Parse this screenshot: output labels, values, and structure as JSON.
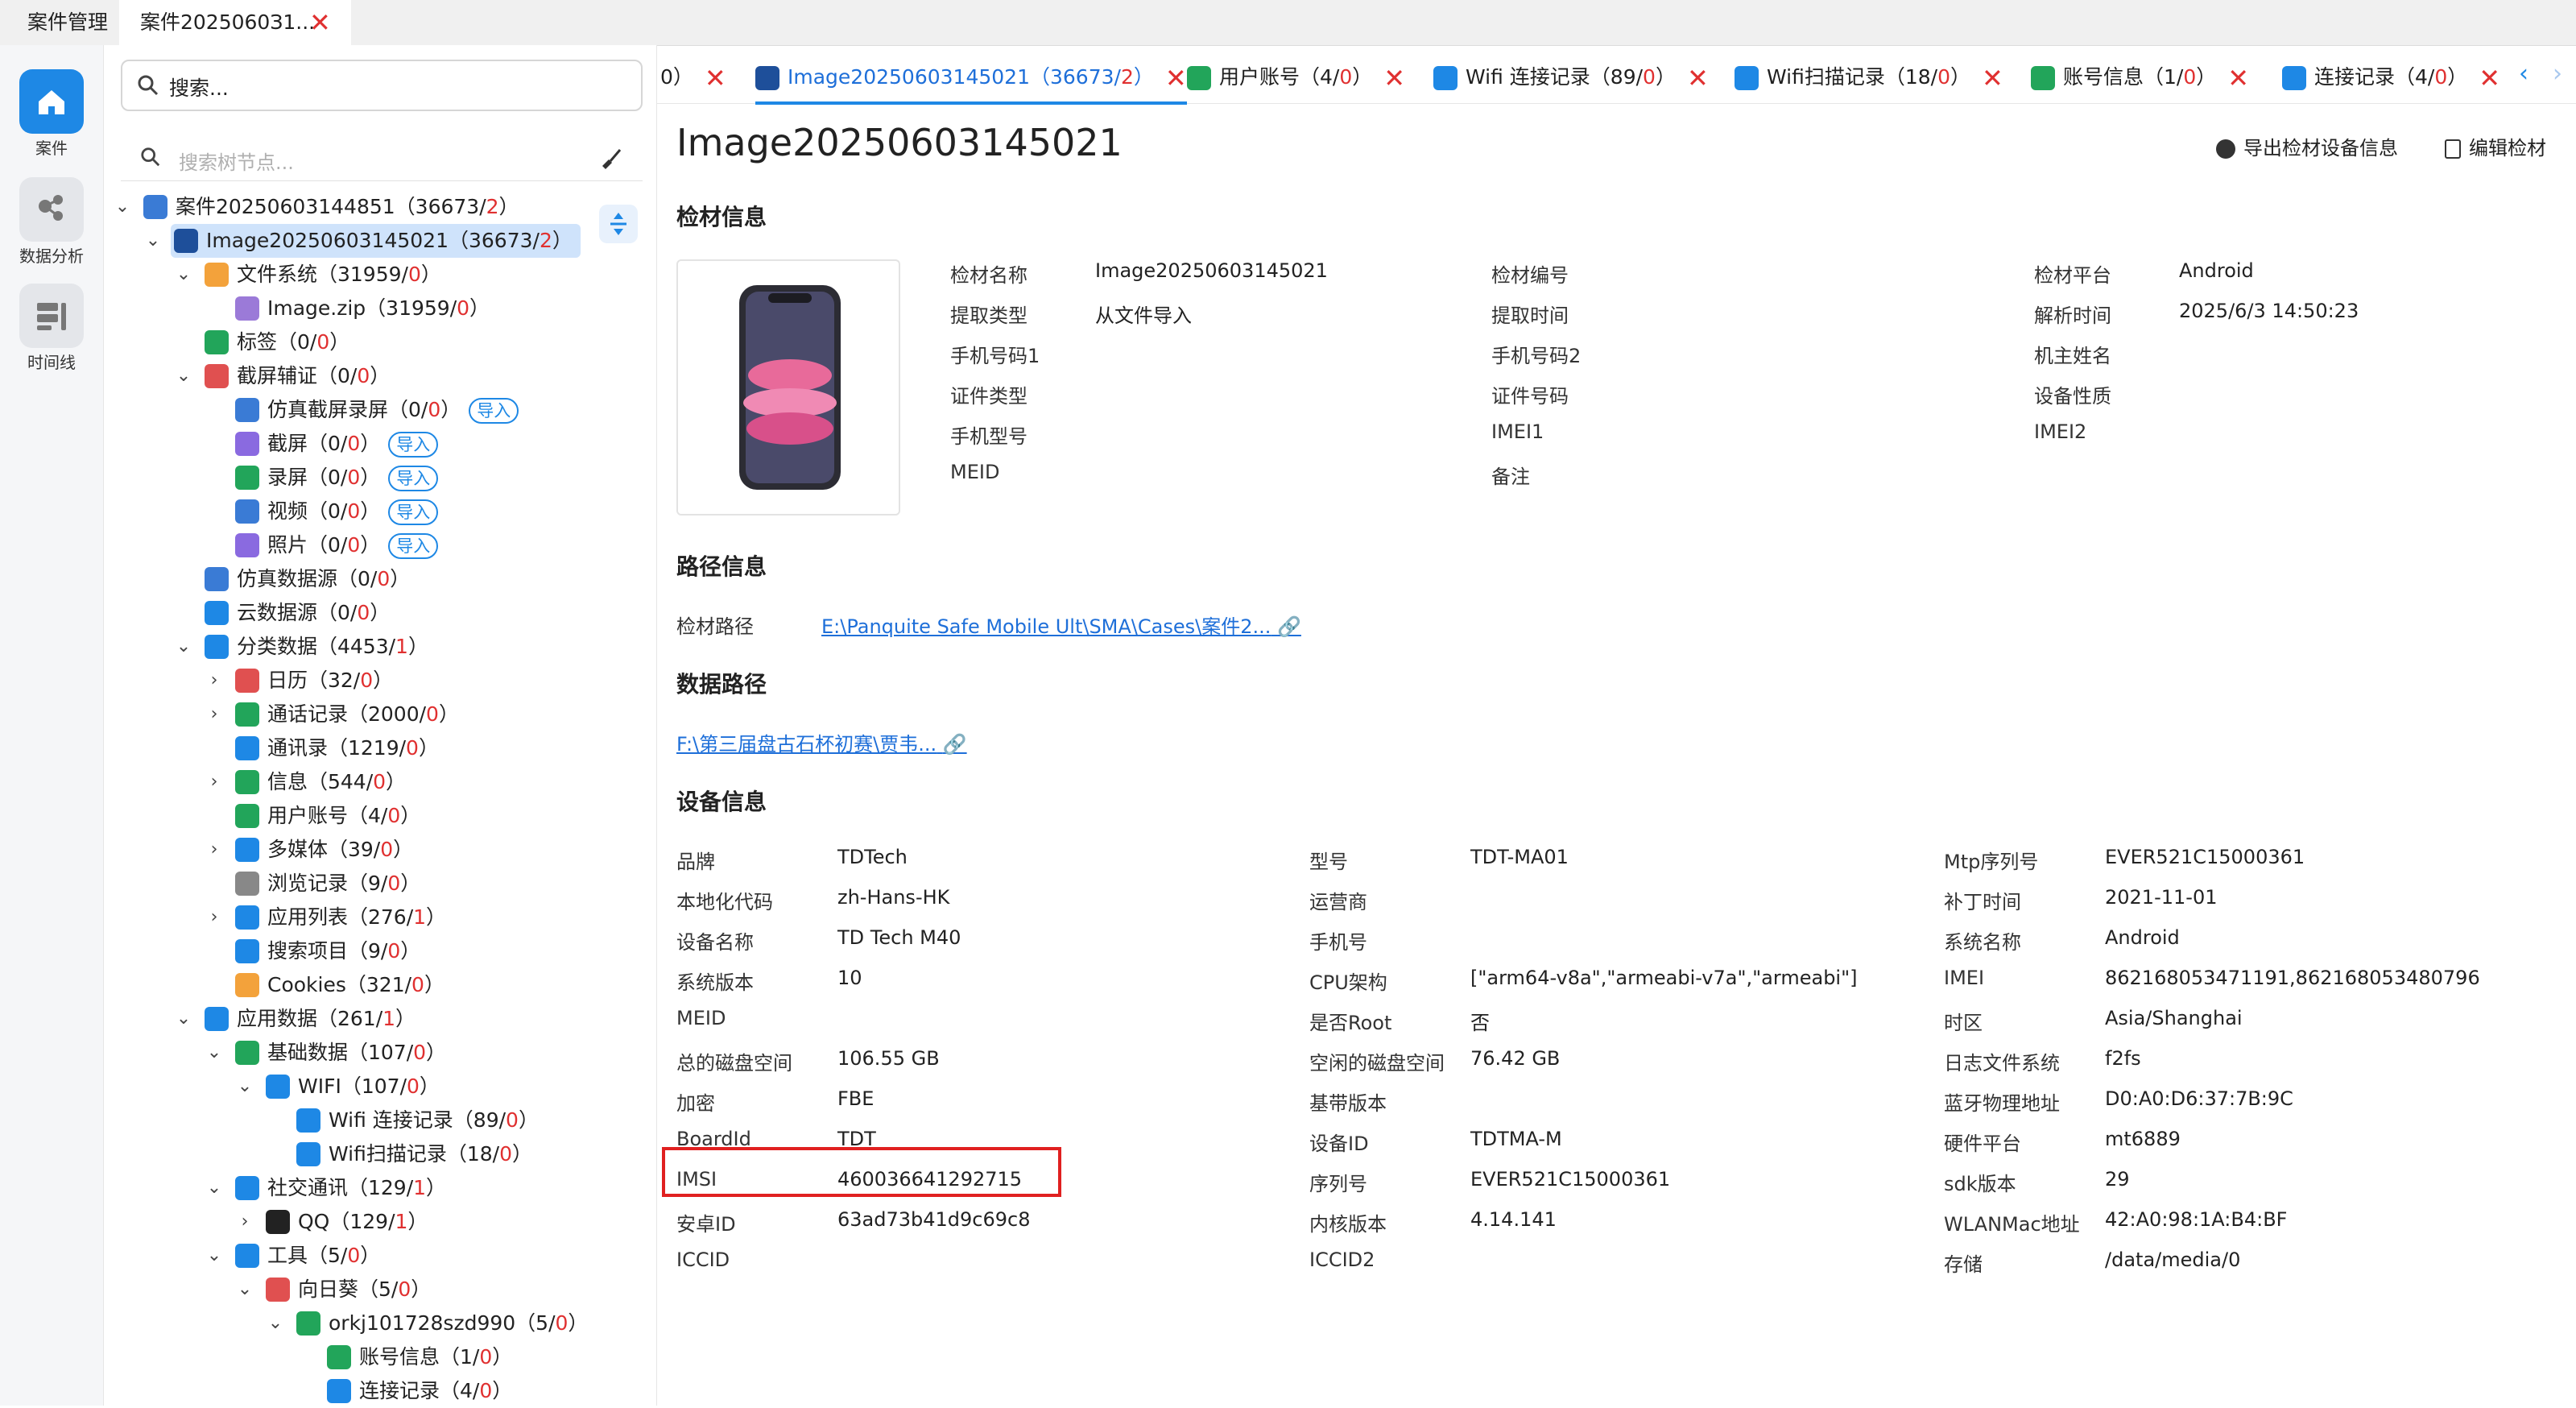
{
  "top_tabs": [
    {
      "label": "案件管理"
    },
    {
      "label": "案件2025060З1..."
    }
  ],
  "rail": [
    {
      "label": "案件"
    },
    {
      "label": "数据分析"
    },
    {
      "label": "时间线"
    }
  ],
  "search": {
    "placeholder": "搜索..."
  },
  "tree_search": {
    "placeholder": "搜索树节点..."
  },
  "tree": [
    {
      "label": "案件20250603144851（36673/",
      "red": "2",
      "end": "）"
    },
    {
      "label": "Image20250603145021（36673/",
      "red": "2",
      "end": "）"
    },
    {
      "label": "文件系统（31959/",
      "red": "0",
      "end": "）"
    },
    {
      "label": "Image.zip（31959/",
      "red": "0",
      "end": "）"
    },
    {
      "label": "标签（0/",
      "red": "0",
      "end": "）"
    },
    {
      "label": "截屏辅证（0/",
      "red": "0",
      "end": "）"
    },
    {
      "label": "仿真截屏录屏（0/",
      "red": "0",
      "end": "）",
      "import": "导入"
    },
    {
      "label": "截屏（0/",
      "red": "0",
      "end": "）",
      "import": "导入"
    },
    {
      "label": "录屏（0/",
      "red": "0",
      "end": "）",
      "import": "导入"
    },
    {
      "label": "视频（0/",
      "red": "0",
      "end": "）",
      "import": "导入"
    },
    {
      "label": "照片（0/",
      "red": "0",
      "end": "）",
      "import": "导入"
    },
    {
      "label": "仿真数据源（0/",
      "red": "0",
      "end": "）"
    },
    {
      "label": "云数据源（0/",
      "red": "0",
      "end": "）"
    },
    {
      "label": "分类数据（4453/",
      "red": "1",
      "end": "）"
    },
    {
      "label": "日历（32/",
      "red": "0",
      "end": "）"
    },
    {
      "label": "通话记录（2000/",
      "red": "0",
      "end": "）"
    },
    {
      "label": "通讯录（1219/",
      "red": "0",
      "end": "）"
    },
    {
      "label": "信息（544/",
      "red": "0",
      "end": "）"
    },
    {
      "label": "用户账号（4/",
      "red": "0",
      "end": "）"
    },
    {
      "label": "多媒体（39/",
      "red": "0",
      "end": "）"
    },
    {
      "label": "浏览记录（9/",
      "red": "0",
      "end": "）"
    },
    {
      "label": "应用列表（276/",
      "red": "1",
      "end": "）"
    },
    {
      "label": "搜索项目（9/",
      "red": "0",
      "end": "）"
    },
    {
      "label": "Cookies（321/",
      "red": "0",
      "end": "）"
    },
    {
      "label": "应用数据（261/",
      "red": "1",
      "end": "）"
    },
    {
      "label": "基础数据（107/",
      "red": "0",
      "end": "）"
    },
    {
      "label": "WIFI（107/",
      "red": "0",
      "end": "）"
    },
    {
      "label": "Wifi 连接记录（89/",
      "red": "0",
      "end": "）"
    },
    {
      "label": "Wifi扫描记录（18/",
      "red": "0",
      "end": "）"
    },
    {
      "label": "社交通讯（129/",
      "red": "1",
      "end": "）"
    },
    {
      "label": "QQ（129/",
      "red": "1",
      "end": "）"
    },
    {
      "label": "工具（5/",
      "red": "0",
      "end": "）"
    },
    {
      "label": "向日葵（5/",
      "red": "0",
      "end": "）"
    },
    {
      "label": "orkj101728szd990（5/",
      "red": "0",
      "end": "）"
    },
    {
      "label": "账号信息（1/",
      "red": "0",
      "end": "）"
    },
    {
      "label": "连接记录（4/",
      "red": "0",
      "end": "）"
    }
  ],
  "content_tabs": [
    {
      "label": "0）"
    },
    {
      "label": "Image20250603145021（36673/",
      "red": "2",
      "end": "）"
    },
    {
      "label": "用户账号（4/",
      "red": "0",
      "end": "）"
    },
    {
      "label": "Wifi 连接记录（89/",
      "red": "0",
      "end": "）"
    },
    {
      "label": "Wifi扫描记录（18/",
      "red": "0",
      "end": "）"
    },
    {
      "label": "账号信息（1/",
      "red": "0",
      "end": "）"
    },
    {
      "label": "连接记录（4/",
      "red": "0",
      "end": "）"
    }
  ],
  "page_title": "Image20250603145021",
  "toolbar": {
    "export": "导出检材设备信息",
    "edit": "编辑检材"
  },
  "sections": {
    "material": "检材信息",
    "path": "路径信息",
    "data_path": "数据路径",
    "device": "设备信息"
  },
  "material_fields": [
    {
      "label": "检材名称",
      "value": "Image20250603145021"
    },
    {
      "label": "检材编号",
      "value": ""
    },
    {
      "label": "检材平台",
      "value": "Android"
    },
    {
      "label": "提取类型",
      "value": "从文件导入"
    },
    {
      "label": "提取时间",
      "value": ""
    },
    {
      "label": "解析时间",
      "value": "2025/6/3 14:50:23"
    },
    {
      "label": "手机号码1",
      "value": ""
    },
    {
      "label": "手机号码2",
      "value": ""
    },
    {
      "label": "机主姓名",
      "value": ""
    },
    {
      "label": "证件类型",
      "value": ""
    },
    {
      "label": "证件号码",
      "value": ""
    },
    {
      "label": "设备性质",
      "value": ""
    },
    {
      "label": "手机型号",
      "value": ""
    },
    {
      "label": "IMEI1",
      "value": ""
    },
    {
      "label": "IMEI2",
      "value": ""
    },
    {
      "label": "MEID",
      "value": ""
    },
    {
      "label": "备注",
      "value": ""
    }
  ],
  "path_info": {
    "label": "检材路径",
    "value": "E:\\Panquite Safe Mobile Ult\\SMA\\Cases\\案件2..."
  },
  "data_path": {
    "value": "F:\\第三届盘古石杯初赛\\贾韦..."
  },
  "device_fields": [
    {
      "label": "品牌",
      "value": "TDTech"
    },
    {
      "label": "型号",
      "value": "TDT-MA01"
    },
    {
      "label": "Mtp序列号",
      "value": "EVER521C15000361"
    },
    {
      "label": "本地化代码",
      "value": "zh-Hans-HK"
    },
    {
      "label": "运营商",
      "value": ""
    },
    {
      "label": "补丁时间",
      "value": "2021-11-01"
    },
    {
      "label": "设备名称",
      "value": "TD Tech M40"
    },
    {
      "label": "手机号",
      "value": ""
    },
    {
      "label": "系统名称",
      "value": "Android"
    },
    {
      "label": "系统版本",
      "value": "10"
    },
    {
      "label": "CPU架构",
      "value": "[\"arm64-v8a\",\"armeabi-v7a\",\"armeabi\"]"
    },
    {
      "label": "IMEI",
      "value": "862168053471191,862168053480796"
    },
    {
      "label": "MEID",
      "value": ""
    },
    {
      "label": "是否Root",
      "value": "否"
    },
    {
      "label": "时区",
      "value": "Asia/Shanghai"
    },
    {
      "label": "总的磁盘空间",
      "value": "106.55 GB"
    },
    {
      "label": "空闲的磁盘空间",
      "value": "76.42 GB"
    },
    {
      "label": "日志文件系统",
      "value": "f2fs"
    },
    {
      "label": "加密",
      "value": "FBE"
    },
    {
      "label": "基带版本",
      "value": ""
    },
    {
      "label": "蓝牙物理地址",
      "value": "D0:A0:D6:37:7B:9C"
    },
    {
      "label": "BoardId",
      "value": "TDT"
    },
    {
      "label": "设备ID",
      "value": "TDTMA-M"
    },
    {
      "label": "硬件平台",
      "value": "mt6889"
    },
    {
      "label": "IMSI",
      "value": "460036641292715"
    },
    {
      "label": "序列号",
      "value": "EVER521C15000361"
    },
    {
      "label": "sdk版本",
      "value": "29"
    },
    {
      "label": "安卓ID",
      "value": "63ad73b41d9c69c8"
    },
    {
      "label": "内核版本",
      "value": "4.14.141"
    },
    {
      "label": "WLANMac地址",
      "value": "42:A0:98:1A:B4:BF"
    },
    {
      "label": "ICCID",
      "value": ""
    },
    {
      "label": "ICCID2",
      "value": ""
    },
    {
      "label": "存储",
      "value": "/data/media/0"
    }
  ],
  "colors": {
    "accent": "#1e88e5",
    "danger": "#e03030",
    "highlight_box": "#e02020"
  }
}
